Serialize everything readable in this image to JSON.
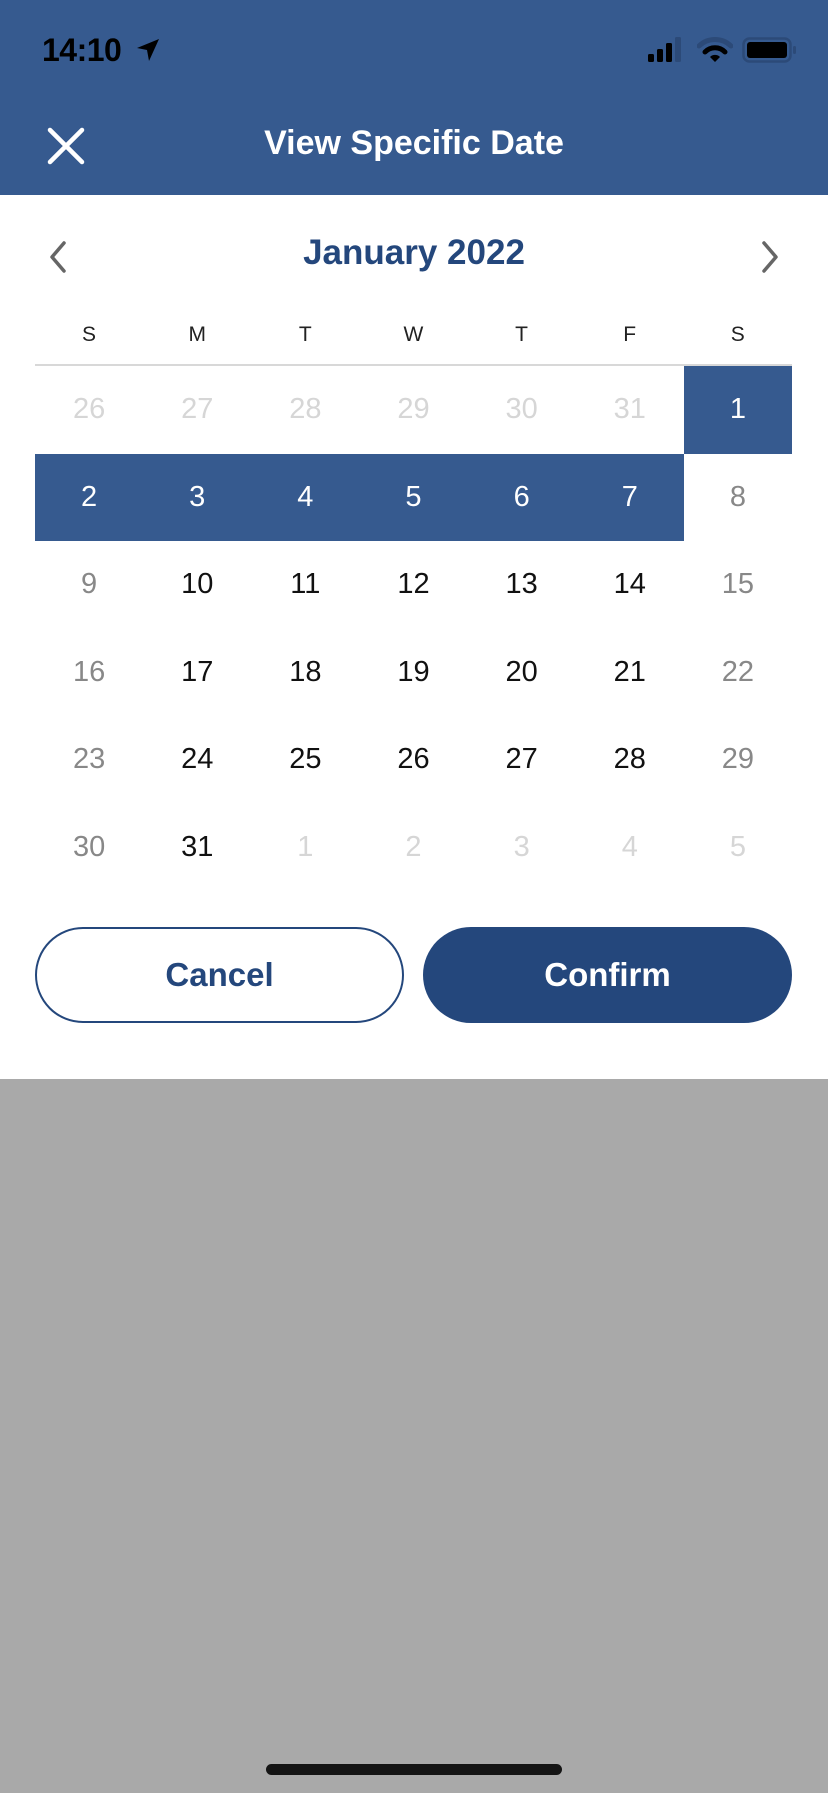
{
  "status_bar": {
    "time": "14:10",
    "location_icon": "location-arrow-icon",
    "signal_icon": "cellular-signal-icon",
    "signal_bars": 3,
    "signal_bars_total": 4,
    "wifi_icon": "wifi-icon",
    "battery_icon": "battery-icon"
  },
  "header": {
    "title": "View Specific Date",
    "close_icon": "close-icon"
  },
  "calendar": {
    "month_title": "January 2022",
    "prev_icon": "chevron-left-icon",
    "next_icon": "chevron-right-icon",
    "weekdays": [
      "S",
      "M",
      "T",
      "W",
      "T",
      "F",
      "S"
    ],
    "days": [
      {
        "label": "26",
        "state": "other"
      },
      {
        "label": "27",
        "state": "other"
      },
      {
        "label": "28",
        "state": "other"
      },
      {
        "label": "29",
        "state": "other"
      },
      {
        "label": "30",
        "state": "other"
      },
      {
        "label": "31",
        "state": "other"
      },
      {
        "label": "1",
        "state": "selected"
      },
      {
        "label": "2",
        "state": "selected"
      },
      {
        "label": "3",
        "state": "selected"
      },
      {
        "label": "4",
        "state": "selected"
      },
      {
        "label": "5",
        "state": "selected"
      },
      {
        "label": "6",
        "state": "selected"
      },
      {
        "label": "7",
        "state": "selected"
      },
      {
        "label": "8",
        "state": "weekend"
      },
      {
        "label": "9",
        "state": "weekend"
      },
      {
        "label": "10",
        "state": "weekday"
      },
      {
        "label": "11",
        "state": "weekday"
      },
      {
        "label": "12",
        "state": "weekday"
      },
      {
        "label": "13",
        "state": "weekday"
      },
      {
        "label": "14",
        "state": "weekday"
      },
      {
        "label": "15",
        "state": "weekend"
      },
      {
        "label": "16",
        "state": "weekend"
      },
      {
        "label": "17",
        "state": "weekday"
      },
      {
        "label": "18",
        "state": "weekday"
      },
      {
        "label": "19",
        "state": "weekday"
      },
      {
        "label": "20",
        "state": "weekday"
      },
      {
        "label": "21",
        "state": "weekday"
      },
      {
        "label": "22",
        "state": "weekend"
      },
      {
        "label": "23",
        "state": "weekend"
      },
      {
        "label": "24",
        "state": "weekday"
      },
      {
        "label": "25",
        "state": "weekday"
      },
      {
        "label": "26",
        "state": "weekday"
      },
      {
        "label": "27",
        "state": "weekday"
      },
      {
        "label": "28",
        "state": "weekday"
      },
      {
        "label": "29",
        "state": "weekend"
      },
      {
        "label": "30",
        "state": "weekend"
      },
      {
        "label": "31",
        "state": "weekday"
      },
      {
        "label": "1",
        "state": "other"
      },
      {
        "label": "2",
        "state": "other"
      },
      {
        "label": "3",
        "state": "other"
      },
      {
        "label": "4",
        "state": "other"
      },
      {
        "label": "5",
        "state": "other"
      }
    ],
    "selected_range": "January 1 – January 7, 2022"
  },
  "actions": {
    "cancel_label": "Cancel",
    "confirm_label": "Confirm"
  },
  "colors": {
    "header_bg": "#365a8f",
    "accent": "#24477c",
    "selected_bg": "#365a8f",
    "backdrop": "#a9a9a9"
  }
}
